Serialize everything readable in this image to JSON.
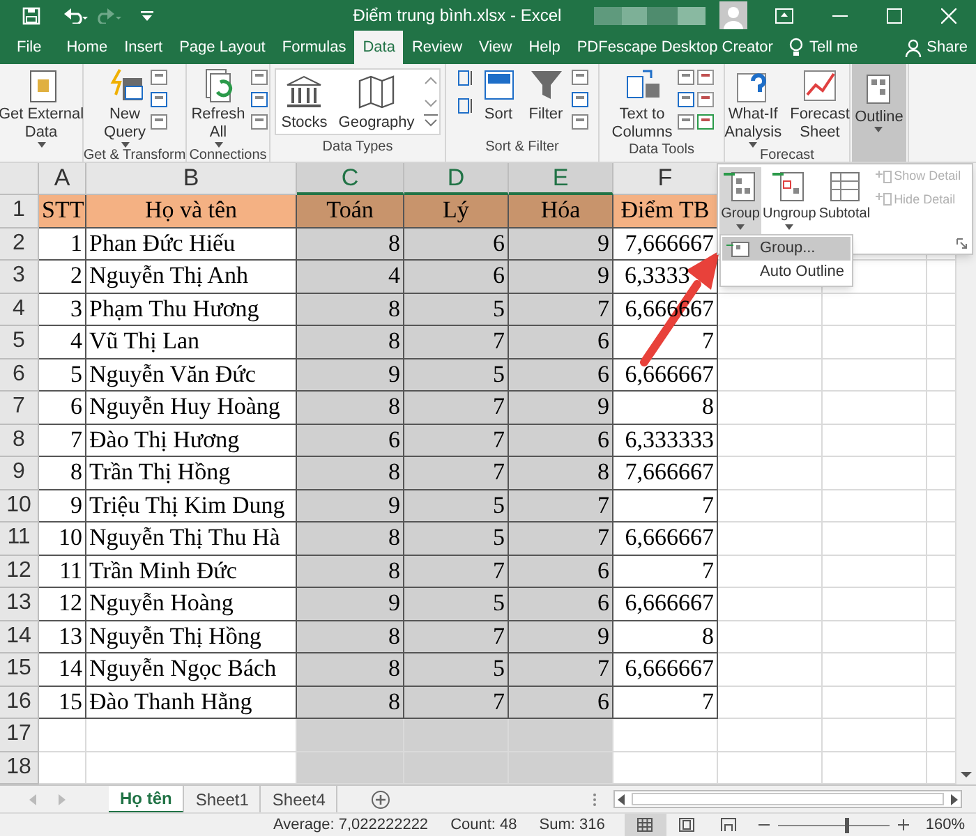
{
  "title_bar": {
    "title": "Điểm trung bình.xlsx  -  Excel"
  },
  "tabs": [
    {
      "label": "File",
      "selected": false
    },
    {
      "label": "Home",
      "selected": false
    },
    {
      "label": "Insert",
      "selected": false
    },
    {
      "label": "Page Layout",
      "selected": false
    },
    {
      "label": "Formulas",
      "selected": false
    },
    {
      "label": "Data",
      "selected": true
    },
    {
      "label": "Review",
      "selected": false
    },
    {
      "label": "View",
      "selected": false
    },
    {
      "label": "Help",
      "selected": false
    },
    {
      "label": "PDFescape Desktop Creator",
      "selected": false
    }
  ],
  "tell_me": "Tell me",
  "share": "Share",
  "ribbon": [
    {
      "kind": "buttons",
      "buttons": [
        {
          "label": "Get External\nData",
          "caret": true,
          "selected": false
        }
      ]
    },
    {
      "kind": "buttons",
      "label": "Get & Transform",
      "buttons": [
        {
          "label": "New\nQuery",
          "caret": true,
          "selected": false
        }
      ]
    },
    {
      "kind": "buttons",
      "label": "Connections",
      "buttons": [
        {
          "label": "Refresh\nAll",
          "caret": true,
          "selected": false
        }
      ]
    },
    {
      "kind": "gallery",
      "label": "Data Types",
      "buttons": [
        {
          "label": "Stocks",
          "caret": false,
          "selected": false
        },
        {
          "label": "Geography",
          "caret": false,
          "selected": false
        }
      ]
    },
    {
      "kind": "buttons",
      "label": "Sort & Filter",
      "buttons": [
        {
          "label": "Sort",
          "caret": false,
          "selected": false
        },
        {
          "label": "Filter",
          "caret": false,
          "selected": false
        }
      ]
    },
    {
      "kind": "buttons",
      "label": "Data Tools",
      "buttons": [
        {
          "label": "Text to\nColumns",
          "caret": false,
          "selected": false
        }
      ]
    },
    {
      "kind": "buttons",
      "label": "Forecast",
      "buttons": [
        {
          "label": "What-If\nAnalysis",
          "caret": true,
          "selected": false
        },
        {
          "label": "Forecast\nSheet",
          "caret": false,
          "selected": false
        }
      ]
    },
    {
      "kind": "buttons",
      "buttons": [
        {
          "label": "Outline",
          "caret": true,
          "selected": true
        }
      ]
    }
  ],
  "grid": {
    "columns": [
      {
        "label": "A",
        "selected": false
      },
      {
        "label": "B",
        "selected": false
      },
      {
        "label": "C",
        "selected": true
      },
      {
        "label": "D",
        "selected": true
      },
      {
        "label": "E",
        "selected": true
      },
      {
        "label": "F",
        "selected": false
      }
    ],
    "rows": [
      {
        "label": "1",
        "kind": "header",
        "cells": [
          "STT",
          "Họ và tên",
          "Toán",
          "Lý",
          "Hóa",
          "Điểm TB"
        ]
      },
      {
        "label": "2",
        "kind": "data",
        "cells": [
          "1",
          "Phan Đức Hiếu",
          "8",
          "6",
          "9",
          "7,666667"
        ]
      },
      {
        "label": "3",
        "kind": "data",
        "cells": [
          "2",
          "Nguyễn Thị Anh",
          "4",
          "6",
          "9",
          "6,3333"
        ]
      },
      {
        "label": "4",
        "kind": "data",
        "cells": [
          "3",
          "Phạm Thu Hương",
          "8",
          "5",
          "7",
          "6,666667"
        ]
      },
      {
        "label": "5",
        "kind": "data",
        "cells": [
          "4",
          "Vũ Thị Lan",
          "8",
          "7",
          "6",
          "7"
        ]
      },
      {
        "label": "6",
        "kind": "data",
        "cells": [
          "5",
          "Nguyễn Văn Đức",
          "9",
          "5",
          "6",
          "6,666667"
        ]
      },
      {
        "label": "7",
        "kind": "data",
        "cells": [
          "6",
          "Nguyễn Huy Hoàng",
          "8",
          "7",
          "9",
          "8"
        ]
      },
      {
        "label": "8",
        "kind": "data",
        "cells": [
          "7",
          "Đào Thị Hương",
          "6",
          "7",
          "6",
          "6,333333"
        ]
      },
      {
        "label": "9",
        "kind": "data",
        "cells": [
          "8",
          "Trần Thị Hồng",
          "8",
          "7",
          "8",
          "7,666667"
        ]
      },
      {
        "label": "10",
        "kind": "data",
        "cells": [
          "9",
          "Triệu Thị Kim Dung",
          "9",
          "5",
          "7",
          "7"
        ]
      },
      {
        "label": "11",
        "kind": "data",
        "cells": [
          "10",
          "Nguyễn Thị Thu Hà",
          "8",
          "5",
          "7",
          "6,666667"
        ]
      },
      {
        "label": "12",
        "kind": "data",
        "cells": [
          "11",
          "Trần Minh Đức",
          "8",
          "7",
          "6",
          "7"
        ]
      },
      {
        "label": "13",
        "kind": "data",
        "cells": [
          "12",
          "Nguyễn Hoàng",
          "9",
          "5",
          "6",
          "6,666667"
        ]
      },
      {
        "label": "14",
        "kind": "data",
        "cells": [
          "13",
          "Nguyễn Thị Hồng",
          "8",
          "7",
          "9",
          "8"
        ]
      },
      {
        "label": "15",
        "kind": "data",
        "cells": [
          "14",
          "Nguyễn Ngọc Bách",
          "8",
          "5",
          "7",
          "6,666667"
        ]
      },
      {
        "label": "16",
        "kind": "data",
        "cells": [
          "15",
          "Đào Thanh Hằng",
          "8",
          "7",
          "6",
          "7"
        ]
      },
      {
        "label": "17",
        "kind": "empty"
      },
      {
        "label": "18",
        "kind": "empty"
      }
    ]
  },
  "outline_panel": {
    "buttons": [
      {
        "label": "Group",
        "selected": true
      },
      {
        "label": "Ungroup",
        "selected": false
      },
      {
        "label": "Subtotal",
        "selected": false
      }
    ],
    "detail_buttons": [
      {
        "label": "Show Detail",
        "disabled": true
      },
      {
        "label": "Hide Detail",
        "disabled": true
      }
    ]
  },
  "group_menu": [
    {
      "label": "Group...",
      "selected": true
    },
    {
      "label": "Auto Outline",
      "selected": false
    }
  ],
  "sheet_tabs": [
    {
      "label": "Họ tên",
      "selected": true
    },
    {
      "label": "Sheet1",
      "selected": false
    },
    {
      "label": "Sheet4",
      "selected": false
    }
  ],
  "status_bar": {
    "average": "Average: 7,022222222",
    "count": "Count: 48",
    "sum": "Sum: 316",
    "zoom": "160%",
    "zoom_level": {
      "level": 0.6
    }
  }
}
